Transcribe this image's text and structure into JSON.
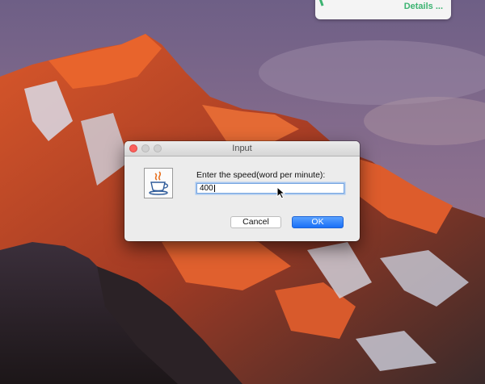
{
  "notification": {
    "link_text": "Details ..."
  },
  "dialog": {
    "title": "Input",
    "prompt": "Enter the speed(word per minute):",
    "input_value": "400",
    "buttons": {
      "cancel": "Cancel",
      "ok": "OK"
    },
    "app_icon": "java-cup-icon"
  },
  "colors": {
    "ok_button": "#1a6ff7",
    "close_light": "#fc605b",
    "notification_link": "#3cb371"
  }
}
